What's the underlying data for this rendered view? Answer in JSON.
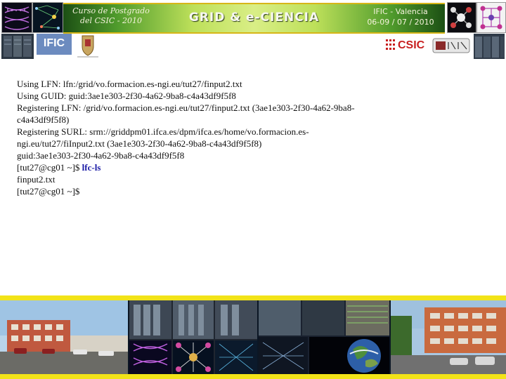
{
  "header": {
    "banner_left_line1": "Curso de Postgrado",
    "banner_left_line2": "del CSIC - 2010",
    "banner_title": "GRID & e-CIENCIA",
    "banner_right_line1": "IFIC - Valencia",
    "banner_right_line2": "06-09 / 07 / 2010",
    "logo_ific": "IFIC",
    "logo_csic": "CSIC"
  },
  "terminal": {
    "lines": [
      "Using LFN: lfn:/grid/vo.formacion.es-ngi.eu/tut27/finput2.txt",
      "Using GUID: guid:3ae1e303-2f30-4a62-9ba8-c4a43df9f5f8",
      "Registering LFN: /grid/vo.formacion.es-ngi.eu/tut27/finput2.txt (3ae1e303-2f30-4a62-9ba8-",
      "c4a43df9f5f8)",
      "Registering SURL: srm://griddpm01.ifca.es/dpm/ifca.es/home/vo.formacion.es-",
      "ngi.eu/tut27/fiInput2.txt (3ae1e303-2f30-4a62-9ba8-c4a43df9f5f8)",
      "guid:3ae1e303-2f30-4a62-9ba8-c4a43df9f5f8"
    ],
    "prompt1": "[tut27@cg01 ~]$ ",
    "command1": "lfc-ls",
    "output1": "finput2.txt",
    "prompt2": "[tut27@cg01 ~]$"
  },
  "colors": {
    "banner_green": "#4f9b2c",
    "accent_yellow": "#f2e318",
    "command_blue": "#1a1aa6"
  }
}
